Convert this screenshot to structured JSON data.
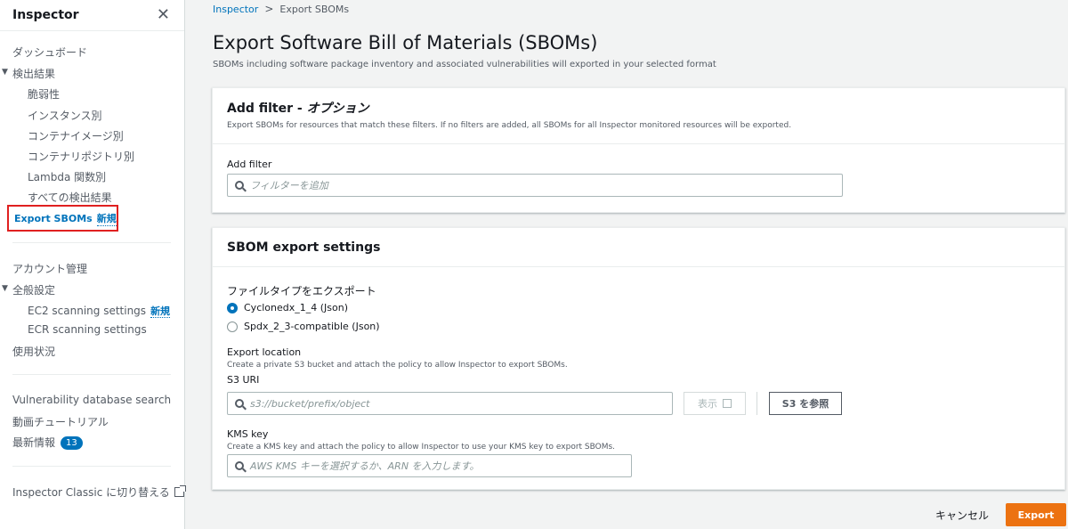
{
  "sidebar": {
    "title": "Inspector",
    "dashboard": "ダッシュボード",
    "findings": "検出結果",
    "findings_items": [
      "脆弱性",
      "インスタンス別",
      "コンテナイメージ別",
      "コンテナリポジトリ別",
      "Lambda 関数別",
      "すべての検出結果"
    ],
    "export_sboms": "Export SBOMs",
    "new_badge": "新規",
    "account_mgmt": "アカウント管理",
    "general_settings": "全般設定",
    "ec2_scanning": "EC2 scanning settings",
    "ecr_scanning": "ECR scanning settings",
    "usage": "使用状況",
    "vuln_db_search": "Vulnerability database search",
    "video_tutorials": "動画チュートリアル",
    "whats_new": "最新情報",
    "whats_new_count": "13",
    "classic_switch": "Inspector Classic に切り替える"
  },
  "breadcrumb": {
    "root": "Inspector",
    "current": "Export SBOMs"
  },
  "page": {
    "title": "Export Software Bill of Materials (SBOMs)",
    "description": "SBOMs including software package inventory and associated vulnerabilities will exported in your selected format"
  },
  "filter_panel": {
    "title_prefix": "Add filter - ",
    "title_optional": "オプション",
    "subtitle": "Export SBOMs for resources that match these filters. If no filters are added, all SBOMs for all Inspector monitored resources will be exported.",
    "field_label": "Add filter",
    "placeholder": "フィルターを追加"
  },
  "export_panel": {
    "title": "SBOM export settings",
    "file_type_label": "ファイルタイプをエクスポート",
    "options": [
      "Cyclonedx_1_4 (Json)",
      "Spdx_2_3-compatible (Json)"
    ],
    "selected_option": "Cyclonedx_1_4 (Json)",
    "location_label": "Export location",
    "location_desc": "Create a private S3 bucket and attach the policy to allow Inspector to export SBOMs.",
    "s3_label": "S3 URI",
    "s3_placeholder": "s3://bucket/prefix/object",
    "view_button": "表示",
    "browse_button": "S3 を参照",
    "kms_label": "KMS key",
    "kms_desc": "Create a KMS key and attach the policy to allow Inspector to use your KMS key to export SBOMs.",
    "kms_placeholder": "AWS KMS キーを選択するか、ARN を入力します。"
  },
  "footer": {
    "cancel": "キャンセル",
    "export": "Export"
  },
  "colors": {
    "accent": "#0073bb",
    "primary_button": "#ec7211",
    "highlight_border": "#e02020"
  }
}
